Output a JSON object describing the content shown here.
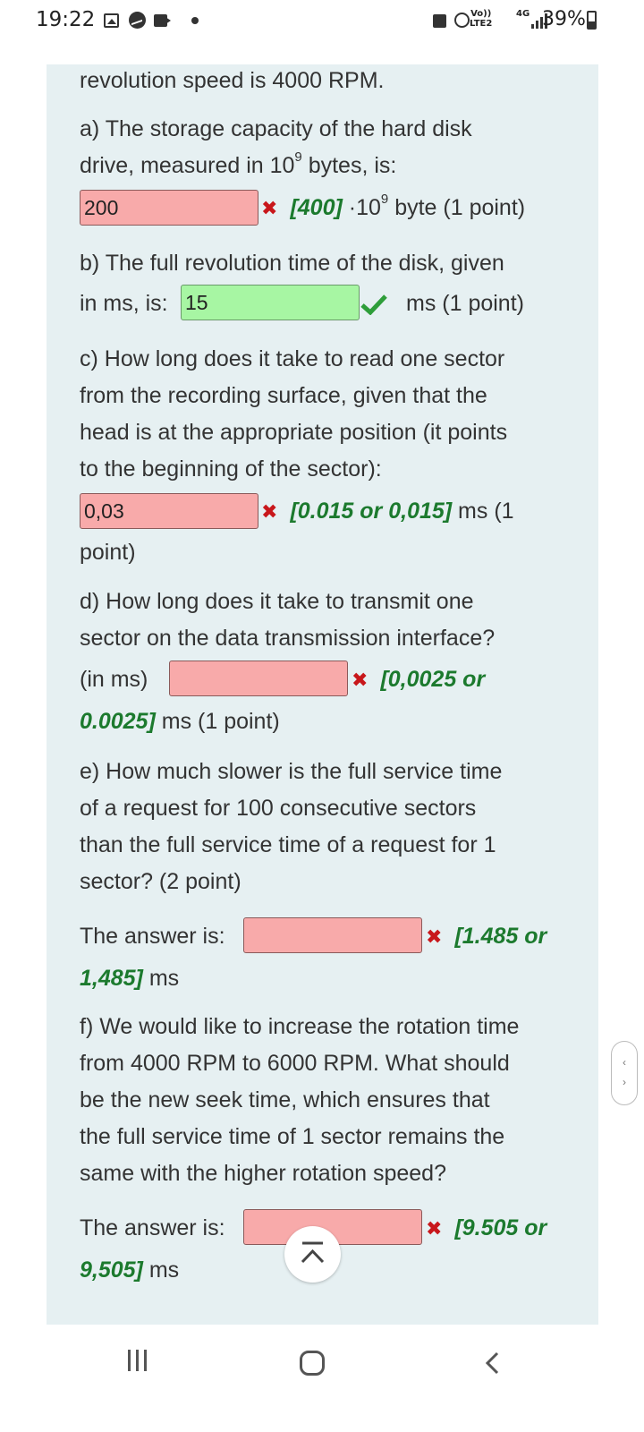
{
  "status_bar": {
    "time": "19:22",
    "volte_top": "Vo))",
    "volte_bottom": "LTE2",
    "network": "4G",
    "battery": "39%",
    "battery_level": 0.39,
    "icons": [
      "image-icon",
      "messenger-icon",
      "video-icon",
      "dot-icon",
      "lock-icon",
      "alarm-icon",
      "signal-icon",
      "battery-icon"
    ]
  },
  "intro_line": "revolution speed is 4000 RPM.",
  "qa": {
    "line1": "a) The storage capacity of the hard disk",
    "line2_pre": "drive, measured in 10",
    "line2_sup": "9",
    "line2_post": " bytes, is:",
    "answer": "200",
    "correct": "[400]",
    "unit_pre": " ·10",
    "unit_sup": "9",
    "unit_post": " byte (1 point)"
  },
  "qb": {
    "line1": "b) The full revolution time of the disk, given",
    "line2": "in ms, is:",
    "answer": "15",
    "suffix": "ms (1 point)"
  },
  "qc": {
    "lines": [
      "c) How long does it take to read one sector",
      "from the recording surface, given that the",
      "head is at the appropriate position (it points",
      "to the beginning of the sector):"
    ],
    "answer": "0,03",
    "correct": "[0.015 or 0,015]",
    "suffix": " ms (1",
    "line_after": "point)"
  },
  "qd": {
    "lines": [
      "d) How long does it take to transmit one",
      "sector on the data transmission interface?"
    ],
    "prefix": "(in ms)",
    "answer": "",
    "correct_part1": "[0,0025 or",
    "correct_part2": "0.0025]",
    "suffix": " ms (1 point)"
  },
  "qe": {
    "lines": [
      "e) How much slower is the full service time",
      "of a request for 100 consecutive sectors",
      "than the full service time of a request for 1",
      "sector? (2 point)"
    ],
    "prefix": "The answer is:",
    "answer": "",
    "correct_part1": "[1.485 or",
    "correct_part2": "1,485]",
    "suffix": " ms"
  },
  "qf": {
    "lines": [
      "f) We would like to increase the rotation time",
      "from 4000 RPM to 6000 RPM. What should",
      "be the new seek time, which ensures that",
      "the full service time of 1 sector remains the",
      "same with the higher rotation speed?"
    ],
    "prefix": "The answer is:",
    "answer": "",
    "correct_part1": "[9.505 or",
    "correct_part2": "9,505]",
    "suffix": " ms"
  },
  "colors": {
    "wrong_fill": "#f8aaaa",
    "right_fill": "#a7f6a3",
    "correct_text": "#1c7a2e",
    "cross": "#c8171b",
    "panel_bg": "#e6f0f2"
  }
}
